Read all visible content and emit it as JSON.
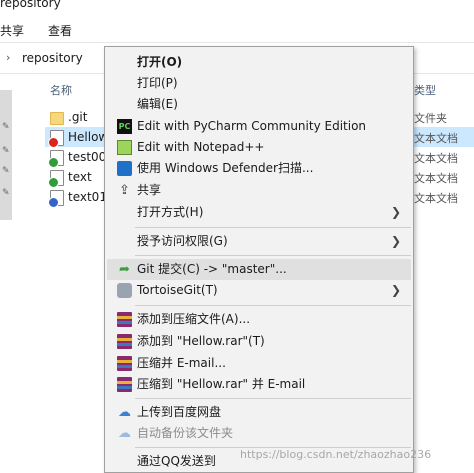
{
  "window": {
    "title": "repository"
  },
  "ribbon": {
    "tabs": [
      "共享",
      "查看"
    ]
  },
  "address": {
    "path": "repository"
  },
  "list": {
    "header_name": "名称",
    "header_type": "类型",
    "rows": [
      {
        "name": ".git",
        "type": "文件夹",
        "icon": "folder-icon"
      },
      {
        "name": "Hellow",
        "type": "文本文档",
        "icon": "text-file-conflict-icon",
        "selected": true
      },
      {
        "name": "test001",
        "type": "文本文档",
        "icon": "text-file-ok-icon"
      },
      {
        "name": "text",
        "type": "文本文档",
        "icon": "text-file-ok-icon"
      },
      {
        "name": "text01",
        "type": "文本文档",
        "icon": "text-file-question-icon"
      }
    ]
  },
  "context_menu": {
    "items": [
      {
        "label": "打开(O)",
        "bold": true
      },
      {
        "label": "打印(P)"
      },
      {
        "label": "编辑(E)"
      },
      {
        "label": "Edit with PyCharm Community Edition",
        "icon": "pycharm-icon",
        "icon_text": "PC"
      },
      {
        "label": "Edit with Notepad++",
        "icon": "notepad-plus-plus-icon"
      },
      {
        "label": "使用 Windows Defender扫描...",
        "icon": "windows-defender-icon"
      },
      {
        "label": "共享",
        "icon": "share-icon"
      },
      {
        "label": "打开方式(H)",
        "submenu": true
      },
      {
        "label": "授予访问权限(G)",
        "submenu": true
      },
      {
        "label": "Git 提交(C) -> \"master\"...",
        "icon": "git-commit-icon",
        "highlighted": true
      },
      {
        "label": "TortoiseGit(T)",
        "icon": "tortoisegit-icon",
        "submenu": true
      },
      {
        "label": "添加到压缩文件(A)...",
        "icon": "winrar-icon"
      },
      {
        "label": "添加到 \"Hellow.rar\"(T)",
        "icon": "winrar-icon"
      },
      {
        "label": "压缩并 E-mail...",
        "icon": "winrar-icon"
      },
      {
        "label": "压缩到 \"Hellow.rar\" 并 E-mail",
        "icon": "winrar-icon"
      },
      {
        "label": "上传到百度网盘",
        "icon": "baidu-netdisk-icon"
      },
      {
        "label": "自动备份该文件夹",
        "icon": "baidu-netdisk-icon",
        "disabled": true
      },
      {
        "label": "通过QQ发送到",
        "icon": "qq-icon"
      }
    ],
    "submenu_arrow": "❯"
  },
  "watermark": "https://blog.csdn.net/zhaozhao236"
}
